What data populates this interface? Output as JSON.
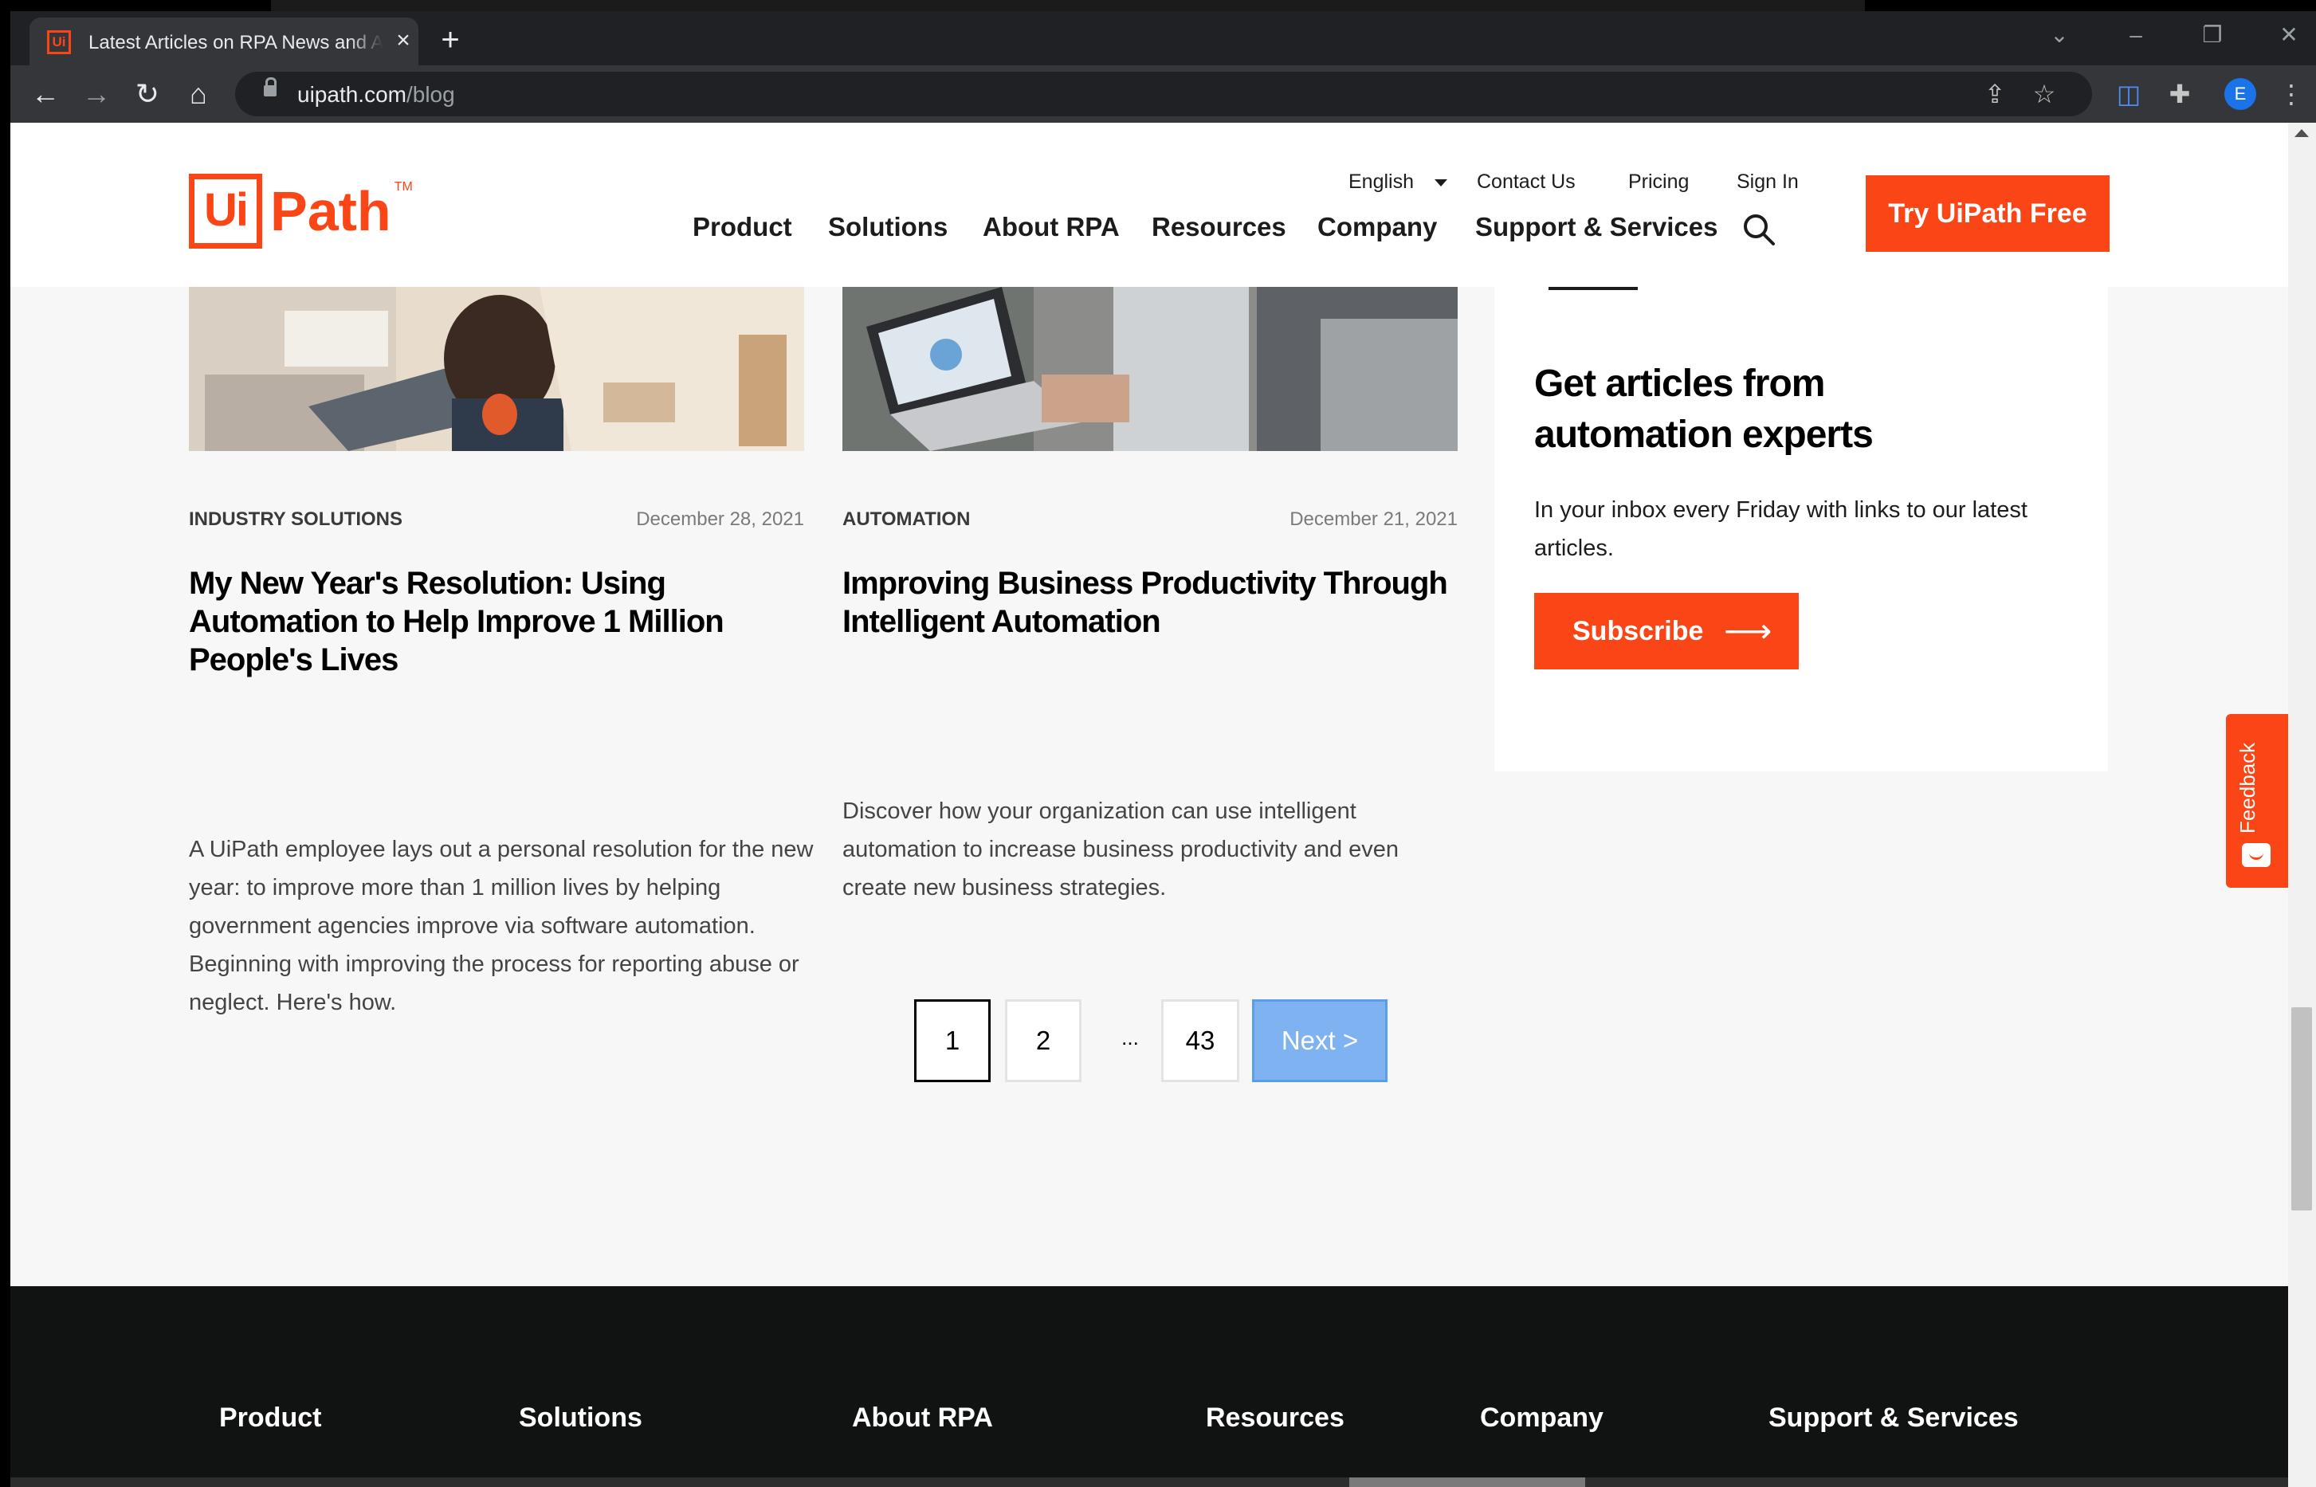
{
  "browser": {
    "tab_title": "Latest Articles on RPA News and Automation",
    "new_tab_symbol": "+",
    "url_host": "uipath.com",
    "url_path": "/blog",
    "profile_initial": "E"
  },
  "header": {
    "logo_ui": "Ui",
    "logo_path": "Path",
    "logo_tm": "TM",
    "language": "English",
    "contact": "Contact Us",
    "pricing": "Pricing",
    "signin": "Sign In",
    "nav": [
      "Product",
      "Solutions",
      "About RPA",
      "Resources",
      "Company",
      "Support & Services"
    ],
    "cta": "Try UiPath Free"
  },
  "articles": [
    {
      "category": "INDUSTRY SOLUTIONS",
      "date": "December 28, 2021",
      "title": "My New Year's Resolution: Using Automation to Help Improve 1 Million People's Lives",
      "description": "A UiPath employee lays out a personal resolution for the new year: to improve more than 1 million lives by helping government agencies improve via software automation. Beginning with improving the process for reporting abuse or neglect. Here's how."
    },
    {
      "category": "AUTOMATION",
      "date": "December 21, 2021",
      "title": "Improving Business Productivity Through Intelligent Automation",
      "description": "Discover how your organization can use intelligent automation to increase business productivity and even create new business strategies."
    }
  ],
  "sidebar": {
    "heading": "Get articles from automation experts",
    "text": "In your inbox every Friday with links to our latest articles.",
    "button": "Subscribe"
  },
  "feedback": "Feedback",
  "pagination": {
    "pages": [
      "1",
      "2",
      "...",
      "43"
    ],
    "next": "Next  >",
    "current": "1"
  },
  "footer": {
    "nav": [
      "Product",
      "Solutions",
      "About RPA",
      "Resources",
      "Company",
      "Support & Services"
    ]
  },
  "colors": {
    "brand": "#fa4616",
    "next_button": "#7fb2f0"
  }
}
